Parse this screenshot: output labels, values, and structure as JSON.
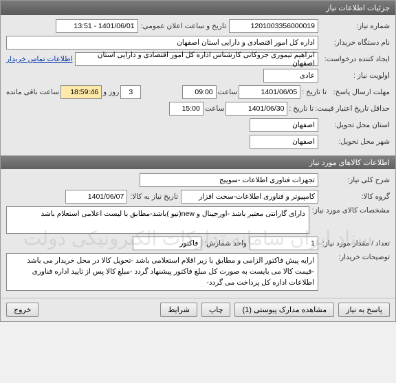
{
  "window_title": "جزئیات اطلاعات نیاز",
  "section1": {
    "need_no_label": "شماره نیاز:",
    "need_no": "1201003356000019",
    "announce_label": "تاریخ و ساعت اعلان عمومی:",
    "announce_value": "1401/06/01 - 13:51",
    "buyer_label": "نام دستگاه خریدار:",
    "buyer_value": "اداره کل امور اقتصادی و دارایی استان اصفهان",
    "creator_label": "ایجاد کننده درخواست:",
    "creator_value": "ابراهیم تیموری جروکانی کارشناس اداره کل امور اقتصادی و دارایی استان اصفهان",
    "contact_link": "اطلاعات تماس خریدار",
    "priority_label": "اولویت نیاز :",
    "priority_value": "عادی",
    "deadline_label": "مهلت ارسال پاسخ:",
    "to_date_label": "تا تاریخ :",
    "deadline_date": "1401/06/05",
    "time_label": "ساعت",
    "deadline_time": "09:00",
    "days_remain": "3",
    "days_and": "روز و",
    "time_remain": "18:59:46",
    "time_remain_suffix": "ساعت باقی مانده",
    "price_valid_label": "حداقل تاریخ اعتبار قیمت:",
    "price_valid_date": "1401/06/30",
    "price_valid_time": "15:00",
    "delivery_state_label": "استان محل تحویل:",
    "delivery_state": "اصفهان",
    "delivery_city_label": "شهر محل تحویل:",
    "delivery_city": "اصفهان"
  },
  "section2_title": "اطلاعات کالاهای مورد نیاز",
  "section2": {
    "general_desc_label": "شرح کلی نیاز:",
    "general_desc": "تجهزات فناوری اطلاعات -سوییج",
    "goods_group_label": "گروه کالا:",
    "goods_group": "کامپیوتر و فناوری اطلاعات-سخت افزار",
    "need_date_label": "تاریخ نیاز به کالا:",
    "need_date": "1401/06/07",
    "goods_spec_label": "مشخصات کالای مورد نیاز:",
    "goods_spec": "دارای گارانتی معتبر باشد -اورجینال و new(نیو )باشد-مطابق با لیست اعلامی استعلام باشد",
    "qty_label": "تعداد / مقدار مورد نیاز:",
    "qty": "1",
    "unit_label": "واحد شمارش:",
    "unit": "فاکتور",
    "buyer_notes_label": "توضیحات خریدار:",
    "buyer_notes": "ارایه پیش فاکتور الزامی و مطابق با زیر اقلام استعلامی  باشد -تحویل کالا در محل خریدار می باشد -قیمت کالا می بایست به صورت کل مبلغ فاکتور پیشنهاد گردد -مبلغ کالا پس از تایید اداره فناوری اطلاعات اداره کل پرداخت می گردد-"
  },
  "watermark": "ستاد ایران سامانه تدارکات الکترونیکی دولت",
  "footer": {
    "respond": "پاسخ به نیاز",
    "attachments": "مشاهده مدارک پیوستی (1)",
    "print": "چاپ",
    "details": "شرایط",
    "exit": "خروج"
  }
}
